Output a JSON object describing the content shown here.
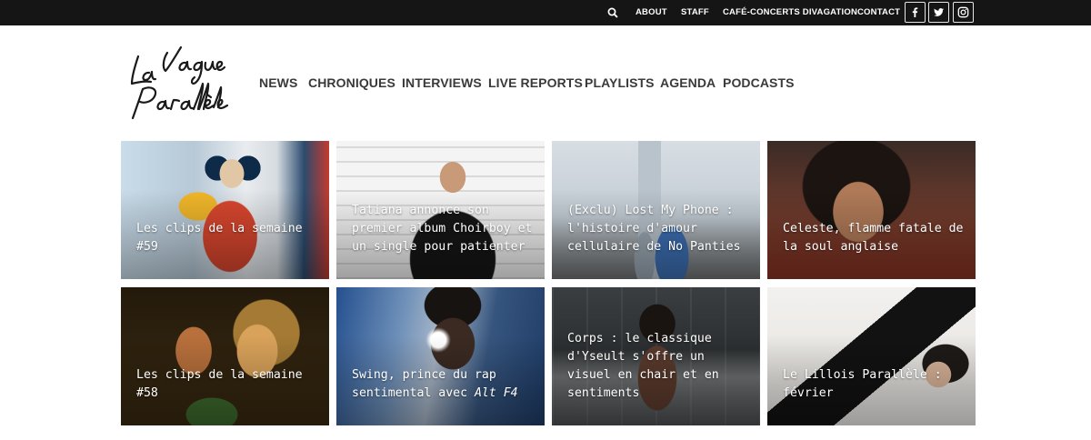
{
  "topbar": {
    "search_icon": "search-icon",
    "links": [
      "ABOUT",
      "STAFF",
      "CAFÉ-CONCERTS DIVAGATION",
      "CONTACT"
    ],
    "social": [
      {
        "name": "facebook",
        "glyph": "f"
      },
      {
        "name": "twitter",
        "glyph": "twitter-bird"
      },
      {
        "name": "instagram",
        "glyph": "instagram-camera"
      }
    ]
  },
  "header": {
    "logo_text": "La Vague Parallèle",
    "nav": [
      "NEWS",
      "CHRONIQUES",
      "INTERVIEWS",
      "LIVE REPORTS",
      "PLAYLISTS",
      "AGENDA",
      "PODCASTS"
    ]
  },
  "articles": [
    {
      "title": "Les clips de la semaine #59"
    },
    {
      "title": "Tatiana annonce son premier album Choirboy et un single pour patienter"
    },
    {
      "title": "(Exclu) Lost My Phone : l'histoire d'amour cellulaire de No Panties"
    },
    {
      "title": "Celeste, flamme fatale de la soul anglaise"
    },
    {
      "title": "Les clips de la semaine #58"
    },
    {
      "title_main": "Swing, prince du rap sentimental avec ",
      "title_em": "Alt F4"
    },
    {
      "title": "Corps : le classique d'Yseult s'offre un visuel en chair et en sentiments"
    },
    {
      "title": "Le Lillois Parallèle : février"
    }
  ],
  "colors": {
    "topbar_bg": "#151515",
    "nav_text": "#3a3a3a",
    "caption_text": "#ffffff"
  }
}
